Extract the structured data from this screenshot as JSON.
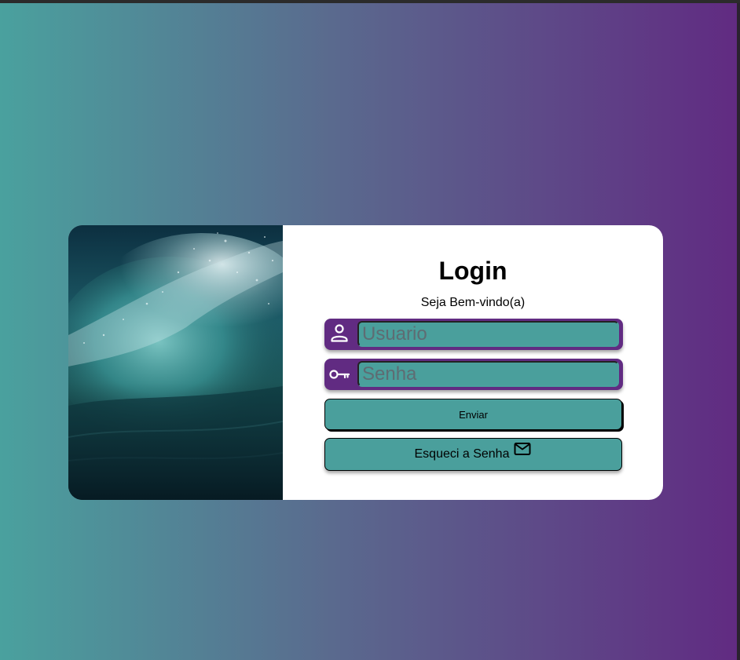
{
  "login": {
    "title": "Login",
    "subtitle": "Seja Bem-vindo(a)",
    "username": {
      "placeholder": "Usuario",
      "value": "",
      "icon": "user-icon"
    },
    "password": {
      "placeholder": "Senha",
      "value": "",
      "icon": "key-icon"
    },
    "submit_label": "Enviar",
    "forgot_label": "Esqueci a Senha",
    "forgot_icon": "mail-icon"
  },
  "colors": {
    "gradient_start": "#4aa19e",
    "gradient_end": "#612b82",
    "field_bg": "#612b82",
    "input_bg": "#4a9f9c",
    "card_bg": "#ffffff"
  },
  "image": {
    "subject": "ocean-wave-photo"
  }
}
